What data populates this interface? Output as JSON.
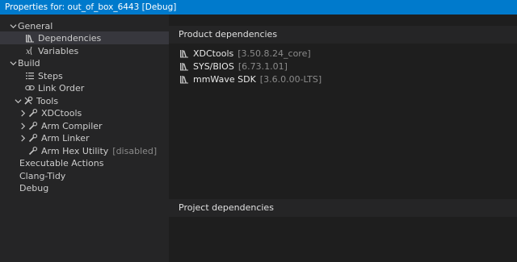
{
  "window": {
    "title": "Properties for: out_of_box_6443 [Debug]"
  },
  "tree": {
    "general": "General",
    "dependencies": "Dependencies",
    "variables": "Variables",
    "build": "Build",
    "steps": "Steps",
    "link_order": "Link Order",
    "tools": "Tools",
    "xdctools": "XDCtools",
    "arm_compiler": "Arm Compiler",
    "arm_linker": "Arm Linker",
    "arm_hex_utility": "Arm Hex Utility",
    "arm_hex_status": "[disabled]",
    "executable_actions": "Executable Actions",
    "clang_tidy": "Clang-Tidy",
    "debug": "Debug"
  },
  "product_dependencies": {
    "header": "Product dependencies",
    "items": [
      {
        "name": "XDCtools",
        "version": "[3.50.8.24_core]"
      },
      {
        "name": "SYS/BIOS",
        "version": "[6.73.1.01]"
      },
      {
        "name": "mmWave SDK",
        "version": "[3.6.0.00-LTS]"
      }
    ]
  },
  "project_dependencies": {
    "header": "Project dependencies"
  },
  "colors": {
    "titlebar": "#007acc",
    "selection": "#37373d",
    "panel": "#1e1e1e",
    "sidebar": "#252526"
  }
}
